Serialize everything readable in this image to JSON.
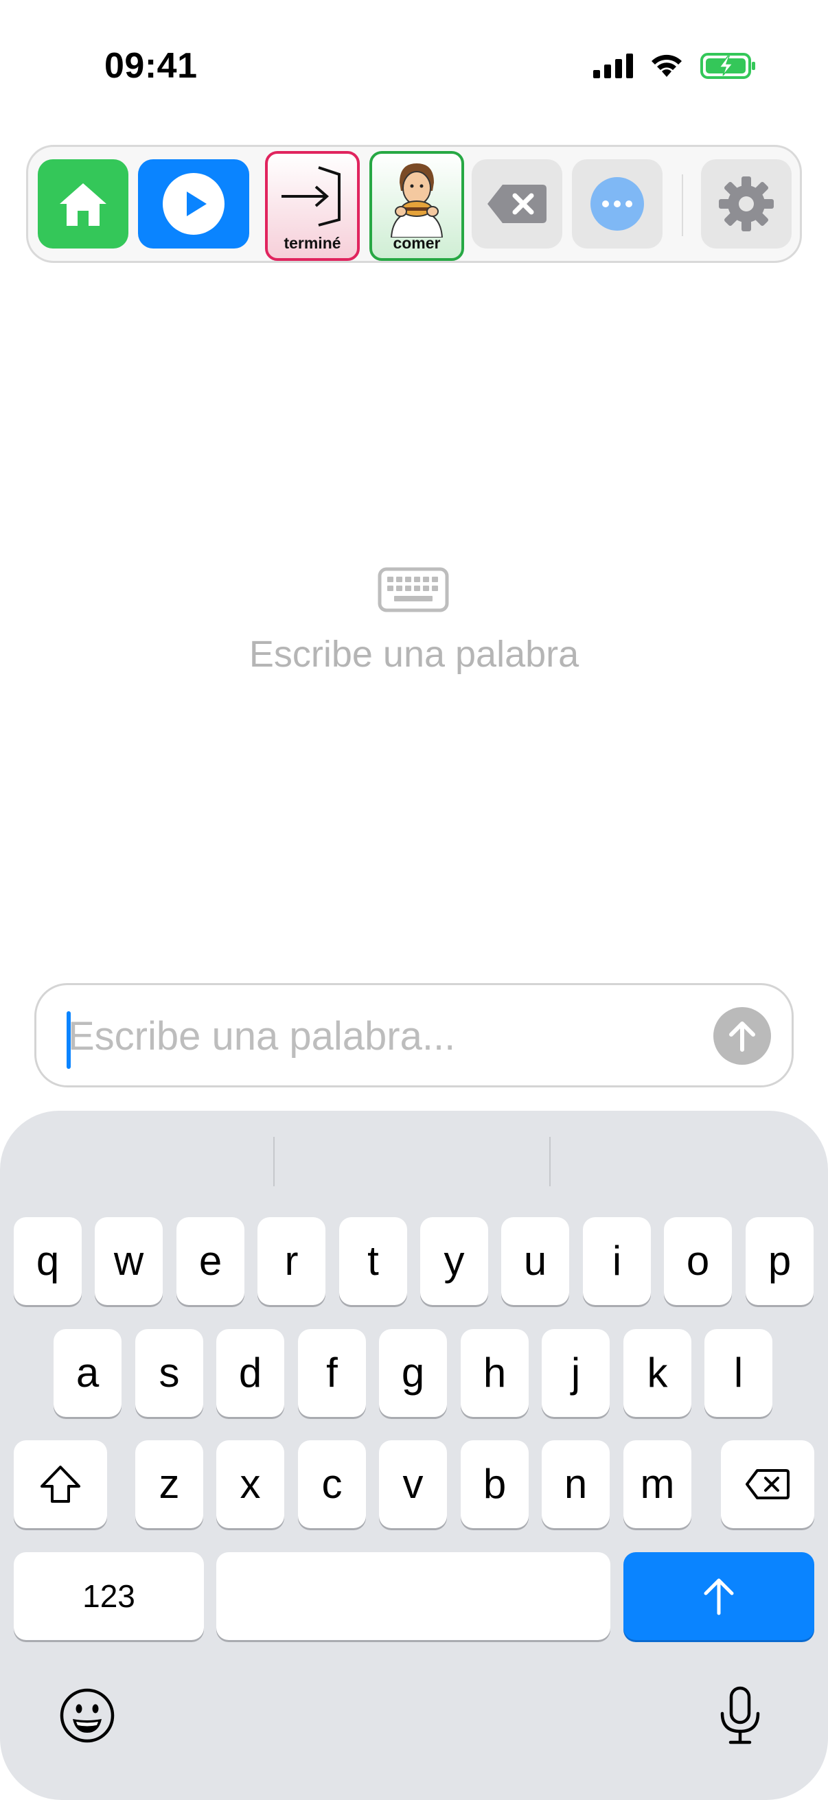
{
  "status": {
    "time": "09:41"
  },
  "toolbar": {
    "home_label": "home",
    "cards": [
      {
        "label": "terminé",
        "border_color": "#e0245e"
      },
      {
        "label": "comer",
        "border_color": "#27a844"
      }
    ]
  },
  "empty_state": {
    "message": "Escribe una palabra"
  },
  "input": {
    "value": "",
    "placeholder": "Escribe una palabra..."
  },
  "keyboard": {
    "row1": [
      "q",
      "w",
      "e",
      "r",
      "t",
      "y",
      "u",
      "i",
      "o",
      "p"
    ],
    "row2": [
      "a",
      "s",
      "d",
      "f",
      "g",
      "h",
      "j",
      "k",
      "l"
    ],
    "row3": [
      "z",
      "x",
      "c",
      "v",
      "b",
      "n",
      "m"
    ],
    "numbers_key": "123",
    "space_key": "",
    "accent_color": "#0a84ff"
  }
}
